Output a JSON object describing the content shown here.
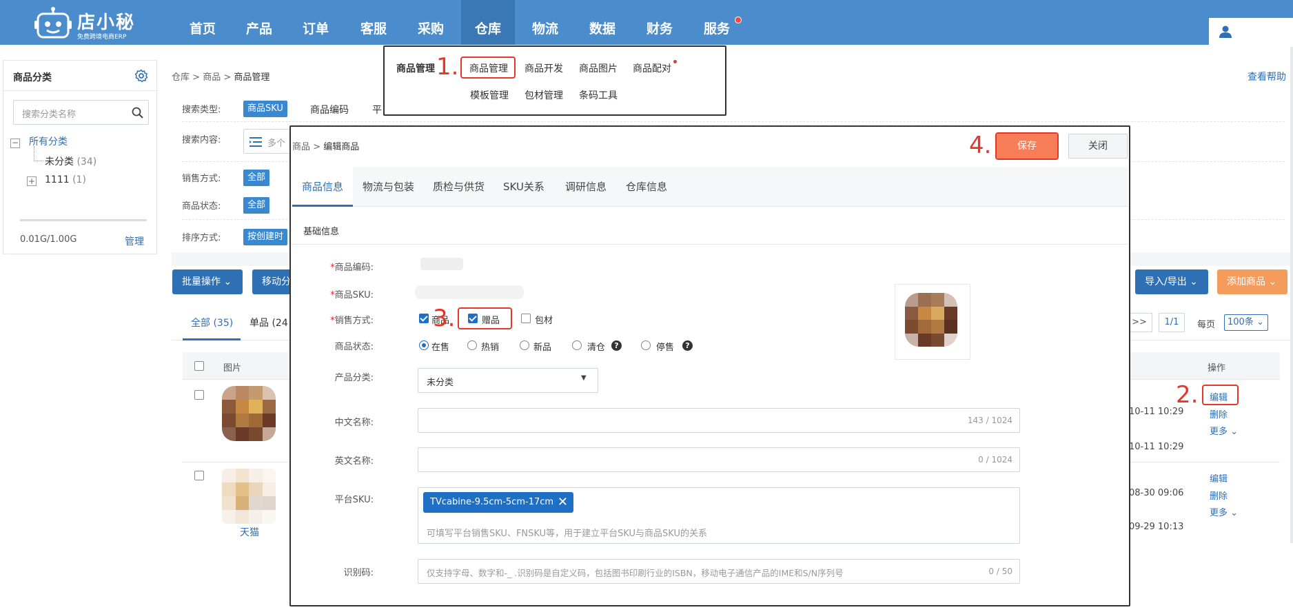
{
  "topnav": {
    "logo_title": "店小秘",
    "logo_subtitle": "免费跨境电商ERP",
    "items": [
      "首页",
      "产品",
      "订单",
      "客服",
      "采购",
      "仓库",
      "物流",
      "数据",
      "财务",
      "服务"
    ],
    "active_index": 5
  },
  "dropdown": {
    "group_label": "商品管理",
    "row1": [
      "商品管理",
      "商品开发",
      "商品图片",
      "商品配对"
    ],
    "row2": [
      "模板管理",
      "包材管理",
      "条码工具"
    ]
  },
  "sidebar": {
    "title": "商品分类",
    "search_placeholder": "搜索分类名称",
    "all_label": "所有分类",
    "uncategorized_label": "未分类",
    "uncategorized_count": "(34)",
    "item1_label": "1111",
    "item1_count": "(1)",
    "storage": "0.01G/1.00G",
    "manage_label": "管理"
  },
  "breadcrumb": {
    "a": "仓库",
    "b": "商品",
    "c": "商品管理",
    "help": "查看帮助"
  },
  "filters": {
    "search_type_label": "搜索类型:",
    "search_type_active": "商品SKU",
    "search_type_other": "商品编码",
    "search_type_more": "平",
    "search_content_label": "搜索内容:",
    "search_content_ph": "多个",
    "sales_label": "销售方式:",
    "sales_active": "全部",
    "status_label": "商品状态:",
    "status_active": "全部",
    "sort_label": "排序方式:",
    "sort_active": "按创建时"
  },
  "actions": {
    "batch": "批量操作",
    "move": "移动分",
    "import_export": "导入/导出",
    "add": "添加商品"
  },
  "list": {
    "tab_all": "全部 (35)",
    "tab_single": "单品 (24",
    "col_image": "图片",
    "col_ops": "操作",
    "pager_next": ">>",
    "pager_page": "1/1",
    "per_page_label": "每页",
    "per_page_value": "100条",
    "row1_time_a": "10-11 10:29",
    "row1_time_b": "10-11 10:29",
    "row2_time_a": "08-30 09:06",
    "row2_time_b": "09-29 10:13",
    "row2_shop": "天猫",
    "op_edit": "编辑",
    "op_delete": "删除",
    "op_more": "更多"
  },
  "modal": {
    "crumb_a": "商品",
    "crumb_b": "编辑商品",
    "save": "保存",
    "close": "关闭",
    "tabs": [
      "商品信息",
      "物流与包装",
      "质检与供货",
      "SKU关系",
      "调研信息",
      "仓库信息"
    ],
    "section": "基础信息",
    "f_code": "商品编码:",
    "f_sku": "商品SKU:",
    "f_sales": "销售方式:",
    "sales_opts": [
      "商品",
      "赠品",
      "包材"
    ],
    "f_status": "商品状态:",
    "status_opts": [
      "在售",
      "热销",
      "新品",
      "清仓",
      "停售"
    ],
    "f_category": "产品分类:",
    "category_value": "未分类",
    "f_cn_name": "中文名称:",
    "cn_count": "143 / 1024",
    "f_en_name": "英文名称:",
    "en_count": "0 / 1024",
    "f_platform_sku": "平台SKU:",
    "platform_sku_chip": "TVcabine-9.5cm-5cm-17cm",
    "platform_sku_hint": "可填写平台销售SKU、FNSKU等，用于建立平台SKU与商品SKU的关系",
    "f_idcode": "识别码:",
    "idcode_ph": "仅支持字母、数字和-_ .识别码是自定义码，包括图书印刷行业的ISBN，移动电子通信产品的IME和S/N序列号",
    "idcode_count": "0 / 50"
  },
  "annotations": [
    "1.",
    "2.",
    "3.",
    "4."
  ],
  "colors": {
    "nav": "#4a8ccc",
    "accent": "#2f6fb3",
    "save": "#f77e57",
    "annotation": "#e5362a"
  }
}
